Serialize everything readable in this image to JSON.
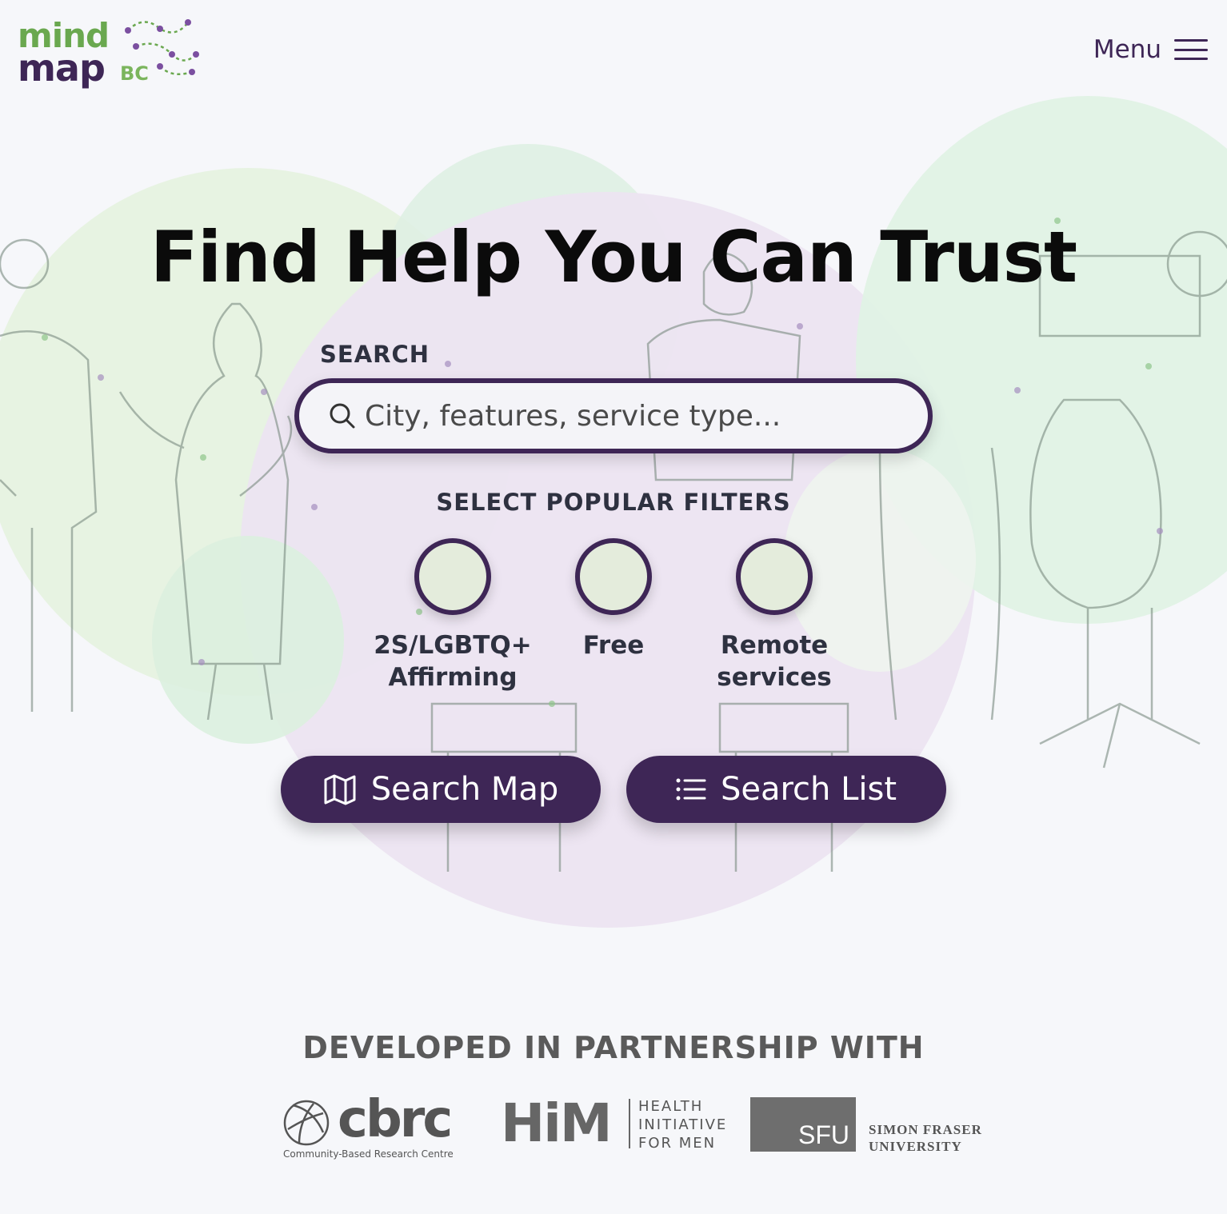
{
  "header": {
    "logo": {
      "line1": "mind",
      "line2": "map",
      "suffix": "BC"
    },
    "menu_label": "Menu"
  },
  "hero": {
    "title": "Find Help You Can Trust",
    "search_label": "SEARCH",
    "search_placeholder": "City, features, service type...",
    "filters_label": "SELECT POPULAR FILTERS",
    "filters": [
      {
        "label": "2S/LGBTQ+ Affirming"
      },
      {
        "label": "Free"
      },
      {
        "label": "Remote services"
      }
    ],
    "buttons": {
      "search_map": "Search Map",
      "search_list": "Search List"
    }
  },
  "partners": {
    "label": "DEVELOPED IN PARTNERSHIP WITH",
    "cbrc": {
      "name": "cbrc",
      "subtitle": "Community-Based Research Centre"
    },
    "him": {
      "name": "HiM",
      "subtitle_lines": [
        "HEALTH",
        "INITIATIVE",
        "FOR MEN"
      ]
    },
    "sfu": {
      "name": "SFU",
      "subtitle_lines": [
        "SIMON FRASER",
        "UNIVERSITY"
      ]
    }
  },
  "colors": {
    "brand_purple": "#3e2656",
    "brand_green": "#6aa84f",
    "filter_fill": "#e4ecdc",
    "background": "#f6f7fa"
  }
}
